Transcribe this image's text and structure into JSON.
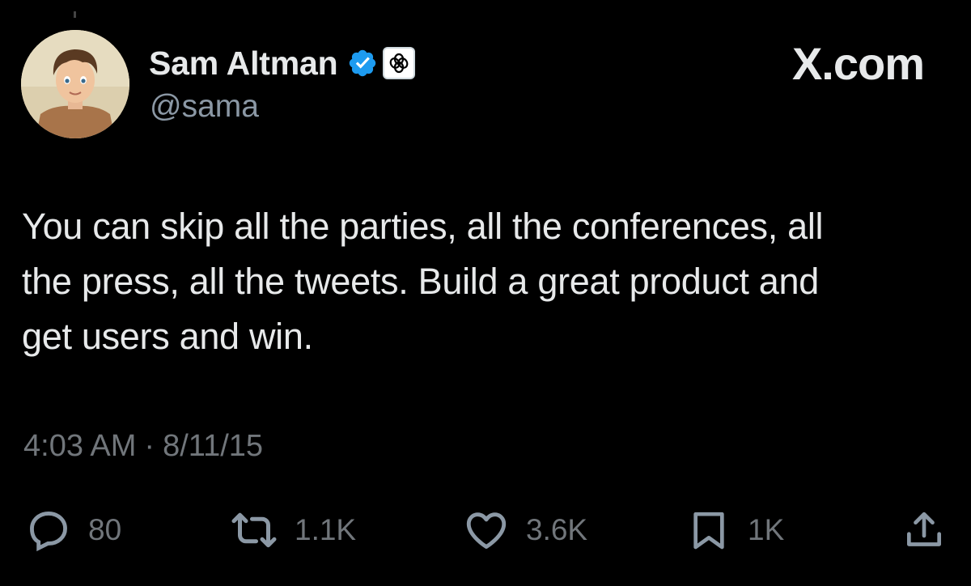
{
  "author": {
    "display_name": "Sam Altman",
    "handle": "@sama",
    "verified_icon": "verified-badge-icon",
    "affiliate_icon": "openai-logo-icon"
  },
  "brand": {
    "label": "X.com"
  },
  "tweet": {
    "text": "You can skip all the parties, all the conferences, all\nthe press, all the tweets.  Build a great product and\nget users and win.",
    "time": "4:03 AM",
    "separator": "·",
    "date": "8/11/15"
  },
  "actions": {
    "reply": {
      "icon": "reply-icon",
      "count": "80"
    },
    "retweet": {
      "icon": "retweet-icon",
      "count": "1.1K"
    },
    "like": {
      "icon": "heart-icon",
      "count": "3.6K"
    },
    "bookmark": {
      "icon": "bookmark-icon",
      "count": "1K"
    },
    "share": {
      "icon": "share-icon"
    }
  },
  "colors": {
    "background": "#000000",
    "primary_text": "#e7e9ea",
    "secondary_text": "#71767b",
    "verified_blue": "#1d9bf0"
  }
}
